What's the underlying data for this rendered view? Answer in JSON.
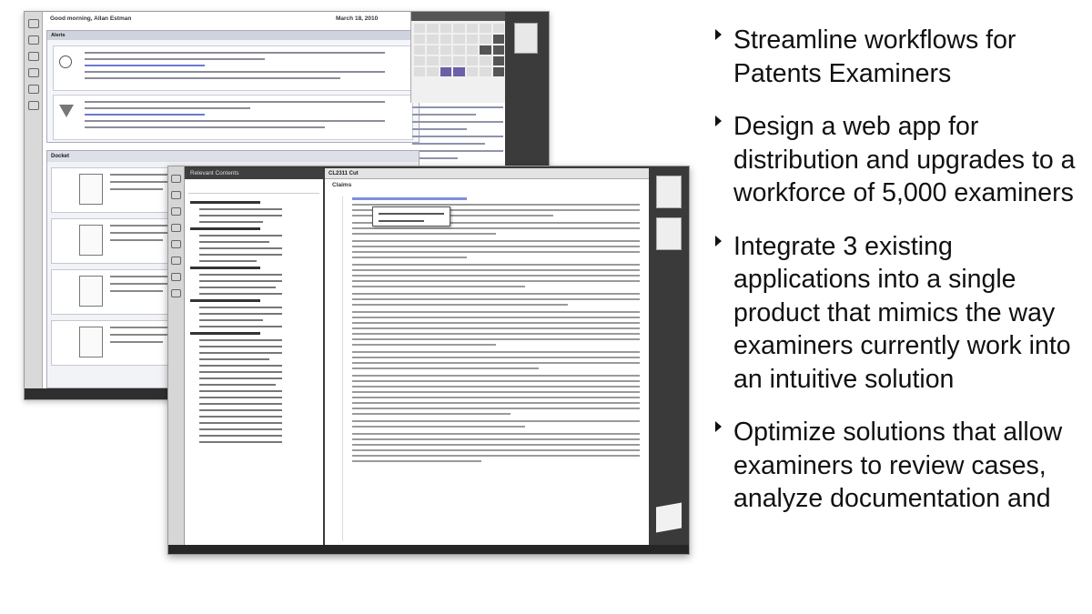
{
  "colors": {
    "background": "#ffffff",
    "text": "#111111",
    "app_dark": "#3a3a3a",
    "highlight": "#7d8fe0",
    "accent_purple": "#6b5fa8"
  },
  "bullets": [
    {
      "icon": "triangle-bullet-icon",
      "text": "Streamline workflows for Patents Examiners"
    },
    {
      "icon": "triangle-bullet-icon",
      "text": "Design a web app for distribution and upgrades to a workforce of 5,000 examiners"
    },
    {
      "icon": "triangle-bullet-icon",
      "text": "Integrate 3 existing applications into a single product that mimics the way examiners currently work into an intuitive solution"
    },
    {
      "icon": "triangle-bullet-icon",
      "text": "Optimize solutions that allow examiners to review cases, analyze documentation and"
    }
  ],
  "screenshot_back": {
    "greeting": "Good morning, Allan Estman",
    "date": "March 18, 2010",
    "alerts_header": "Alerts",
    "docket_header": "Docket"
  },
  "screenshot_front": {
    "panel_title": "Relevant Contents",
    "tab_label": "CL2311 Cut",
    "claims_header": "Claims"
  }
}
